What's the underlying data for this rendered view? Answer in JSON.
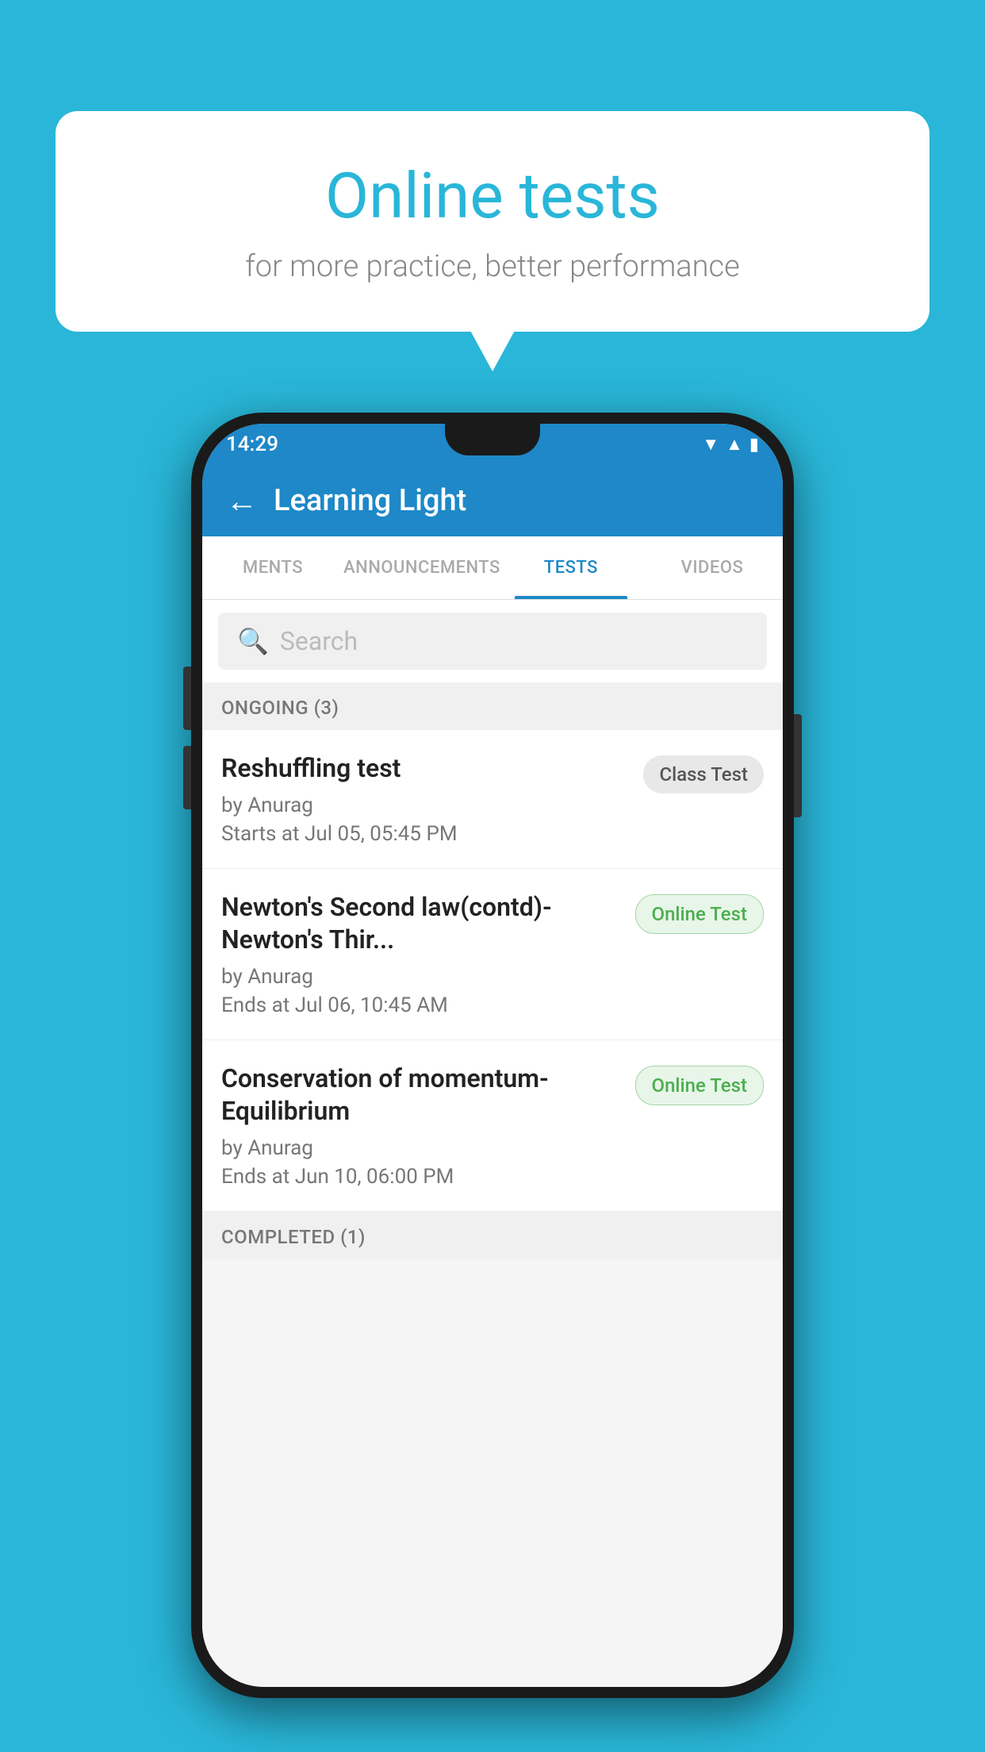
{
  "background": {
    "color": "#29b6d8"
  },
  "speech_bubble": {
    "title": "Online tests",
    "subtitle": "for more practice, better performance"
  },
  "phone": {
    "status_bar": {
      "time": "14:29",
      "icons": [
        "wifi",
        "signal",
        "battery"
      ]
    },
    "app_header": {
      "back_label": "←",
      "title": "Learning Light"
    },
    "tabs": [
      {
        "label": "MENTS",
        "active": false
      },
      {
        "label": "ANNOUNCEMENTS",
        "active": false
      },
      {
        "label": "TESTS",
        "active": true
      },
      {
        "label": "VIDEOS",
        "active": false
      }
    ],
    "search": {
      "placeholder": "Search"
    },
    "sections": [
      {
        "header": "ONGOING (3)",
        "items": [
          {
            "name": "Reshuffling test",
            "author": "by Anurag",
            "time_label": "Starts at",
            "time": "Jul 05, 05:45 PM",
            "badge": "Class Test",
            "badge_type": "class"
          },
          {
            "name": "Newton's Second law(contd)-Newton's Thir...",
            "author": "by Anurag",
            "time_label": "Ends at",
            "time": "Jul 06, 10:45 AM",
            "badge": "Online Test",
            "badge_type": "online"
          },
          {
            "name": "Conservation of momentum-Equilibrium",
            "author": "by Anurag",
            "time_label": "Ends at",
            "time": "Jun 10, 06:00 PM",
            "badge": "Online Test",
            "badge_type": "online"
          }
        ]
      },
      {
        "header": "COMPLETED (1)",
        "items": []
      }
    ]
  }
}
